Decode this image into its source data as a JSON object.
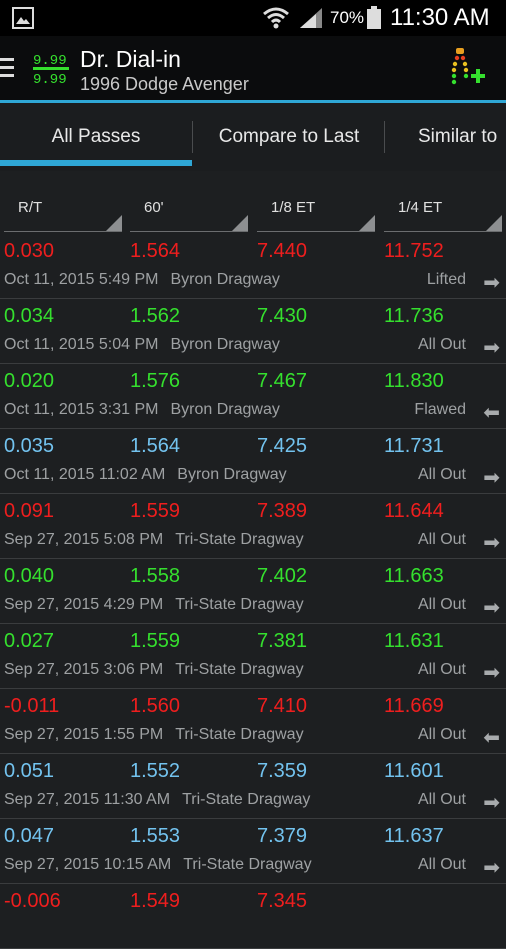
{
  "status_bar": {
    "battery": "70%",
    "time": "11:30 AM"
  },
  "app": {
    "logo_text_top": "9.99",
    "logo_text_bottom": "9.99",
    "title": "Dr. Dial-in",
    "subtitle": "1996 Dodge Avenger"
  },
  "tabs": [
    {
      "label": "All Passes",
      "selected": true
    },
    {
      "label": "Compare to Last",
      "selected": false
    },
    {
      "label": "Similar to",
      "selected": false
    }
  ],
  "columns": [
    "R/T",
    "60'",
    "1/8 ET",
    "1/4 ET"
  ],
  "colors": {
    "red": "#ef1e1e",
    "green": "#35e02e",
    "blue": "#73c3ef",
    "accent": "#2fa7d6"
  },
  "passes": [
    {
      "rt": "0.030",
      "sixty": "1.564",
      "eighth": "7.440",
      "quarter": "11.752",
      "date": "Oct 11, 2015 5:49 PM",
      "track": "Byron Dragway",
      "status": "Lifted",
      "arrow": "➡",
      "color": "red"
    },
    {
      "rt": "0.034",
      "sixty": "1.562",
      "eighth": "7.430",
      "quarter": "11.736",
      "date": "Oct 11, 2015 5:04 PM",
      "track": "Byron Dragway",
      "status": "All Out",
      "arrow": "➡",
      "color": "green"
    },
    {
      "rt": "0.020",
      "sixty": "1.576",
      "eighth": "7.467",
      "quarter": "11.830",
      "date": "Oct 11, 2015 3:31 PM",
      "track": "Byron Dragway",
      "status": "Flawed",
      "arrow": "⬅",
      "color": "green"
    },
    {
      "rt": "0.035",
      "sixty": "1.564",
      "eighth": "7.425",
      "quarter": "11.731",
      "date": "Oct 11, 2015 11:02 AM",
      "track": "Byron Dragway",
      "status": "All Out",
      "arrow": "➡",
      "color": "blue"
    },
    {
      "rt": "0.091",
      "sixty": "1.559",
      "eighth": "7.389",
      "quarter": "11.644",
      "date": "Sep 27, 2015 5:08 PM",
      "track": "Tri-State Dragway",
      "status": "All Out",
      "arrow": "➡",
      "color": "red"
    },
    {
      "rt": "0.040",
      "sixty": "1.558",
      "eighth": "7.402",
      "quarter": "11.663",
      "date": "Sep 27, 2015 4:29 PM",
      "track": "Tri-State Dragway",
      "status": "All Out",
      "arrow": "➡",
      "color": "green"
    },
    {
      "rt": "0.027",
      "sixty": "1.559",
      "eighth": "7.381",
      "quarter": "11.631",
      "date": "Sep 27, 2015 3:06 PM",
      "track": "Tri-State Dragway",
      "status": "All Out",
      "arrow": "➡",
      "color": "green"
    },
    {
      "rt": "-0.011",
      "sixty": "1.560",
      "eighth": "7.410",
      "quarter": "11.669",
      "date": "Sep 27, 2015 1:55 PM",
      "track": "Tri-State Dragway",
      "status": "All Out",
      "arrow": "⬅",
      "color": "red"
    },
    {
      "rt": "0.051",
      "sixty": "1.552",
      "eighth": "7.359",
      "quarter": "11.601",
      "date": "Sep 27, 2015 11:30 AM",
      "track": "Tri-State Dragway",
      "status": "All Out",
      "arrow": "➡",
      "color": "blue"
    },
    {
      "rt": "0.047",
      "sixty": "1.553",
      "eighth": "7.379",
      "quarter": "11.637",
      "date": "Sep 27, 2015 10:15 AM",
      "track": "Tri-State Dragway",
      "status": "All Out",
      "arrow": "➡",
      "color": "blue"
    },
    {
      "rt": "-0.006",
      "sixty": "1.549",
      "eighth": "7.345",
      "quarter": "",
      "date": "",
      "track": "",
      "status": "",
      "arrow": "",
      "color": "red"
    }
  ]
}
